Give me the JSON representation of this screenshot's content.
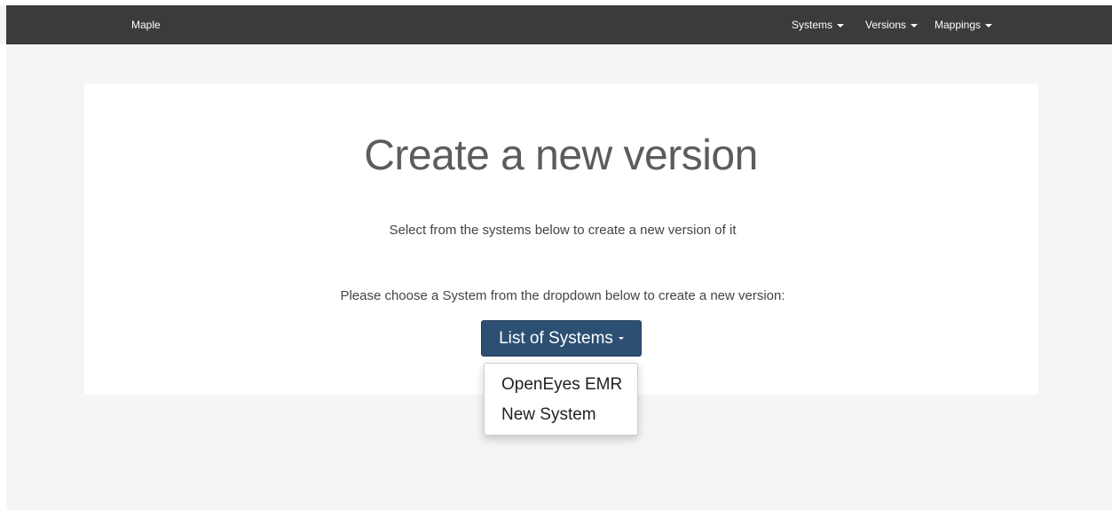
{
  "navbar": {
    "brand": "Maple",
    "menus": [
      {
        "label": "Systems"
      },
      {
        "label": "Versions"
      },
      {
        "label": "Mappings"
      }
    ]
  },
  "main": {
    "title": "Create a new version",
    "subtitle": "Select from the systems below to create a new version of it",
    "instruction": "Please choose a System from the dropdown below to create a new version:",
    "dropdown": {
      "label": "List of Systems",
      "options": [
        "OpenEyes EMR",
        "New System"
      ]
    }
  },
  "colors": {
    "navbar_bg": "#3b3b3b",
    "page_bg": "#f5f5f5",
    "button_bg": "#2c4f72"
  }
}
